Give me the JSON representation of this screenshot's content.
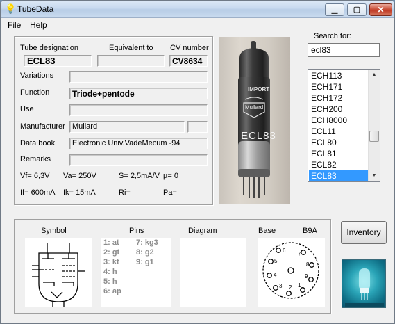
{
  "window": {
    "title": "TubeData"
  },
  "menu": {
    "file": "File",
    "help": "Help"
  },
  "details": {
    "tube_designation_label": "Tube designation",
    "tube_designation": "ECL83",
    "equivalent_label": "Equivalent to",
    "equivalent": "",
    "cv_label": "CV number",
    "cv": "CV8634",
    "variations_label": "Variations",
    "variations": "",
    "function_label": "Function",
    "function": "Triode+pentode",
    "use_label": "Use",
    "use": "",
    "manufacturer_label": "Manufacturer",
    "manufacturer": "Mullard",
    "manufacturer_extra": "",
    "databook_label": "Data book",
    "databook": "Electronic Univ.VadeMecum -94",
    "remarks_label": "Remarks",
    "remarks": ""
  },
  "specs": {
    "vf": "Vf= 6,3V",
    "va": "Va= 250V",
    "s": "S= 2,5mA/V",
    "mu": "µ=   0",
    "if": "If= 600mA",
    "ik": "Ik=  15mA",
    "ri": "Ri=",
    "pa": "Pa="
  },
  "photo": {
    "import_text": "IMPORT",
    "brand": "Mullard",
    "print": "ECL83"
  },
  "search": {
    "label": "Search for:",
    "value": "ecl83",
    "results": [
      "ECH113",
      "ECH171",
      "ECH172",
      "ECH200",
      "ECH8000",
      "ECL11",
      "ECL80",
      "ECL81",
      "ECL82",
      "ECL83"
    ],
    "selected": "ECL83"
  },
  "bottom": {
    "symbol_label": "Symbol",
    "pins_label": "Pins",
    "diagram_label": "Diagram",
    "base_label": "Base",
    "base_value": "B9A",
    "pins_col1": [
      "1: at",
      "2: gt",
      "3: kt",
      "4: h",
      "5: h",
      "6: ap"
    ],
    "pins_col2": [
      "7: kg3",
      "8: g2",
      "9: g1"
    ]
  },
  "inventory_button": "Inventory",
  "colors": {
    "selection": "#3399ff",
    "pins_text": "#8c8c8c"
  }
}
